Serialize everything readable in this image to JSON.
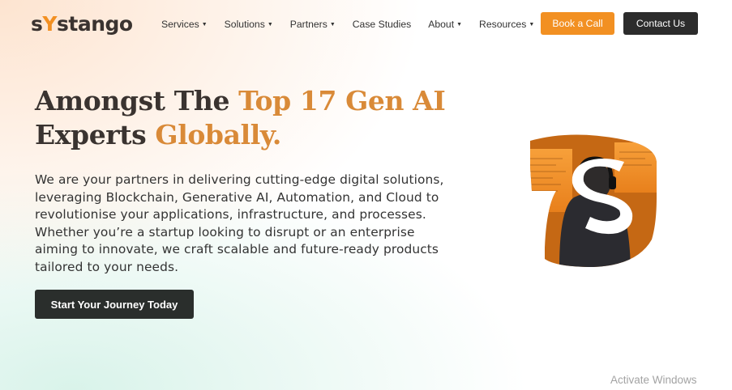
{
  "brand": {
    "logo_s": "s",
    "logo_y": "Y",
    "logo_rest": "stango"
  },
  "nav": {
    "items": [
      {
        "label": "Services",
        "dropdown": true
      },
      {
        "label": "Solutions",
        "dropdown": true
      },
      {
        "label": "Partners",
        "dropdown": true
      },
      {
        "label": "Case Studies",
        "dropdown": false
      },
      {
        "label": "About",
        "dropdown": true
      },
      {
        "label": "Resources",
        "dropdown": true
      }
    ],
    "book_label": "Book a Call",
    "contact_label": "Contact Us"
  },
  "hero": {
    "headline_line1_a": "Amongst The ",
    "headline_line1_b": "Top 17 Gen AI",
    "headline_line2_a": "Experts ",
    "headline_line2_b": "Globally.",
    "description": "We are your partners in delivering cutting-edge digital solutions, leveraging Blockchain, Generative AI, Automation, and Cloud to revolutionise your applications, infrastructure, and processes. Whether you’re a startup looking to disrupt or an enterprise aiming to innovate, we craft scalable and future-ready products tailored to your needs.",
    "cta_label": "Start Your Journey Today"
  },
  "system": {
    "watermark": "Activate Windows"
  },
  "colors": {
    "accent": "#f29022",
    "dark": "#2c2c2c",
    "headline": "#3a3330",
    "headline_accent": "#d98a38"
  },
  "icons": {
    "caret": "caret-down-icon"
  }
}
